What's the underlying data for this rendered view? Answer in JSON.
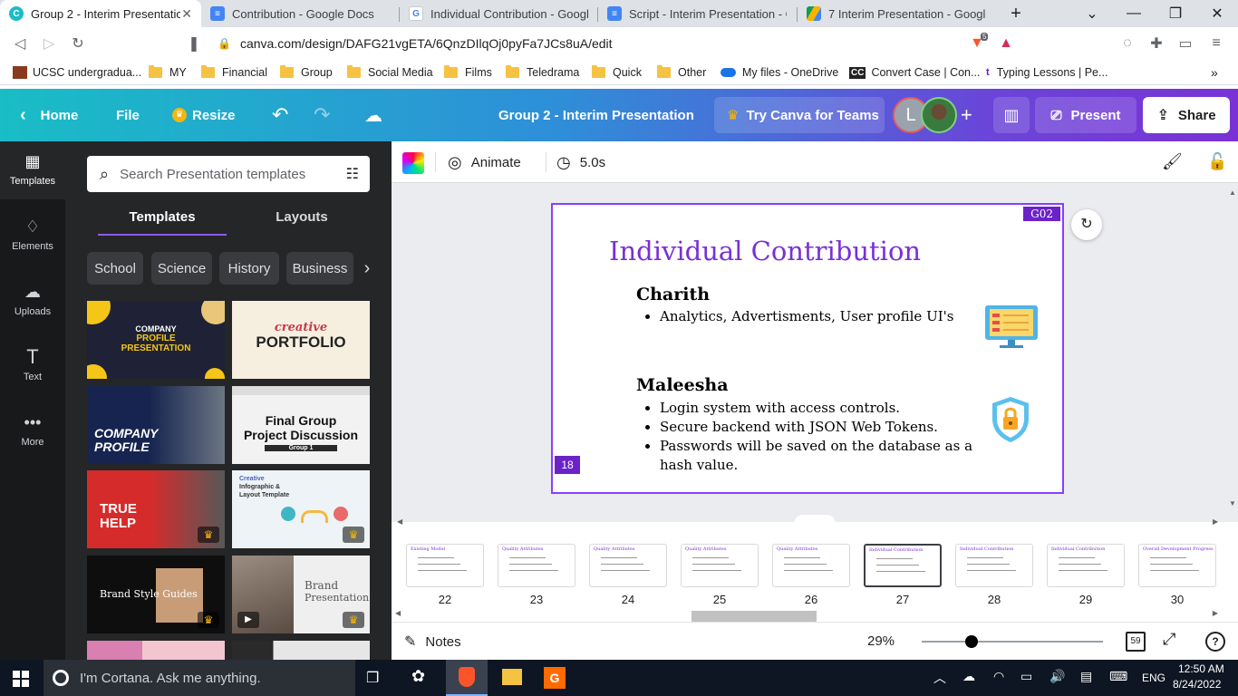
{
  "browser": {
    "tabs": [
      {
        "title": "Group 2 - Interim Presentation",
        "active": true
      },
      {
        "title": "Contribution - Google Docs"
      },
      {
        "title": "Individual Contribution - Google S"
      },
      {
        "title": "Script - Interim Presentation - Goo"
      },
      {
        "title": "7 Interim Presentation - Google D"
      }
    ],
    "url": "canva.com/design/DAFG21vgETA/6QnzDIlqOj0pyFa7JCs8uA/edit",
    "brave_badge": "5",
    "bookmarks": [
      "UCSC undergradua...",
      "MY",
      "Financial",
      "Group",
      "Social Media",
      "Films",
      "Teledrama",
      "Quick",
      "Other",
      "My files - OneDrive",
      "Convert Case | Con...",
      "Typing Lessons | Pe..."
    ]
  },
  "canva_header": {
    "home": "Home",
    "file": "File",
    "resize": "Resize",
    "design_title": "Group 2 -  Interim Presentation",
    "try_teams": "Try Canva for Teams",
    "avatar_letter": "L",
    "present": "Present",
    "share": "Share"
  },
  "rail": [
    {
      "label": "Templates",
      "icon": "templates-icon"
    },
    {
      "label": "Elements",
      "icon": "elements-icon"
    },
    {
      "label": "Uploads",
      "icon": "upload-icon"
    },
    {
      "label": "Text",
      "icon": "text-icon"
    },
    {
      "label": "More",
      "icon": "more-icon"
    }
  ],
  "panel": {
    "search_placeholder": "Search Presentation templates",
    "tabs": [
      "Templates",
      "Layouts"
    ],
    "chips": [
      "School",
      "Science",
      "History",
      "Business"
    ],
    "templates": [
      {
        "line1": "COMPANY",
        "line2": "PROFILE",
        "line3": "PRESENTATION"
      },
      {
        "line1": "creative",
        "line2": "PORTFOLIO"
      },
      {
        "line1": "COMPANY",
        "line2": "PROFILE"
      },
      {
        "line1": "Final Group",
        "line2": "Project Discussion",
        "line3": "Group 1"
      },
      {
        "line1": "TRUE",
        "line2": "HELP"
      },
      {
        "line1": "Creative",
        "line2": "Infographic &",
        "line3": "Layout Template"
      },
      {
        "line1": "Brand Style Guides"
      },
      {
        "line1": "Brand",
        "line2": "Presentation"
      }
    ]
  },
  "toolbar": {
    "animate": "Animate",
    "duration": "5.0s"
  },
  "slide": {
    "tag": "G02",
    "title": "Individual Contribution",
    "person1": "Charith",
    "person1_points": [
      "Analytics, Advertisments, User profile UI's"
    ],
    "person2": "Maleesha",
    "person2_points": [
      "Login system with access controls.",
      "Secure backend with JSON Web Tokens.",
      "Passwords will be saved on the database as a hash value."
    ],
    "page_number": "18"
  },
  "pages": [
    "22",
    "23",
    "24",
    "25",
    "26",
    "27",
    "28",
    "29",
    "30"
  ],
  "page_titles": [
    "Existing Model",
    "Quality Attributes",
    "Quality Attributes",
    "Quality Attributes",
    "Quality Attributes",
    "Individual Contribution",
    "Individual Contribution",
    "Individual Contribution",
    "Overall Development Progress"
  ],
  "bottom": {
    "notes": "Notes",
    "zoom": "29%",
    "zoom_fraction": 0.29,
    "page_count": "59"
  },
  "taskbar": {
    "search_placeholder": "I'm Cortana. Ask me anything.",
    "language": "ENG",
    "time": "12:50 AM",
    "date": "8/24/2022"
  },
  "colors": {
    "accent": "#8b3dff",
    "slide_title": "#7a2fd6",
    "canva_teal": "#19bdc6"
  }
}
